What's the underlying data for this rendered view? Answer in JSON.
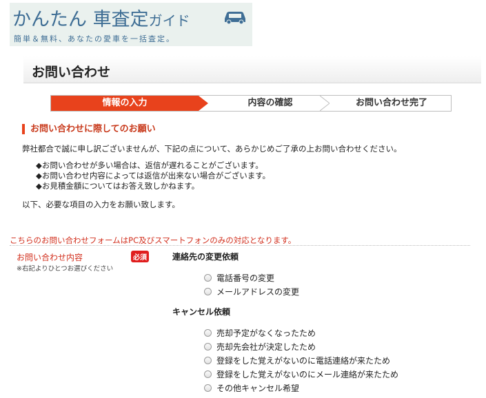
{
  "logo": {
    "title_main": "かんたん 車査定",
    "title_small": "ガイド",
    "tagline": "簡単＆無料、あなたの愛車を一括査定。"
  },
  "page": {
    "title": "お問い合わせ"
  },
  "steps": [
    "情報の入力",
    "内容の確認",
    "お問い合わせ完了"
  ],
  "notice": {
    "heading": "お問い合わせに際してのお願い",
    "intro": "弊社都合で誠に申し訳ございませんが、下記の点について、あらかじめご了承の上お問い合わせください。",
    "bullets": [
      "◆お問い合わせが多い場合は、返信が遅れることがございます。",
      "◆お問い合わせ内容によっては返信が出来ない場合がございます。",
      "◆お見積金額についてはお答え致しかねます。"
    ],
    "outro": "以下、必要な項目の入力をお願い致します。",
    "pc_note": "こちらのお問い合わせフォームはPC及びスマートフォンのみの対応となります。"
  },
  "form": {
    "label": "お問い合わせ内容",
    "sub": "※右記よりひとつお選びください",
    "required": "必須",
    "groups": [
      {
        "title": "連絡先の変更依頼",
        "options": [
          "電話番号の変更",
          "メールアドレスの変更"
        ]
      },
      {
        "title": "キャンセル依頼",
        "options": [
          "売却予定がなくなったため",
          "売却先会社が決定したため",
          "登録をした覚えがないのに電話連絡が来たため",
          "登録をした覚えがないのにメール連絡が来たため",
          "その他キャンセル希望"
        ]
      }
    ]
  },
  "colors": {
    "accent": "#e8421c",
    "brand": "#3f6e95",
    "alert": "#d2301e"
  }
}
